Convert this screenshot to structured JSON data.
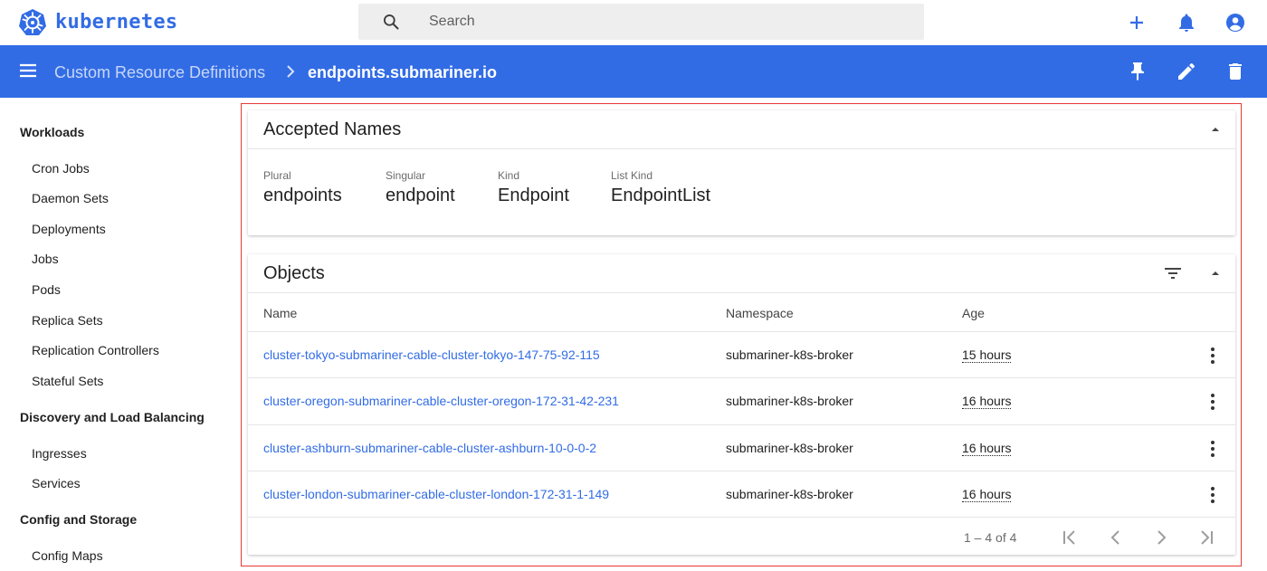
{
  "app": {
    "brand": "kubernetes"
  },
  "search": {
    "placeholder": "Search"
  },
  "topbar_actions": [
    "add-icon",
    "notifications-icon",
    "account-icon"
  ],
  "header": {
    "breadcrumb_parent": "Custom Resource Definitions",
    "breadcrumb_current": "endpoints.submariner.io",
    "actions": [
      "pin-icon",
      "edit-icon",
      "delete-icon"
    ]
  },
  "sidebar": {
    "sections": [
      {
        "title": "Workloads",
        "items": [
          "Cron Jobs",
          "Daemon Sets",
          "Deployments",
          "Jobs",
          "Pods",
          "Replica Sets",
          "Replication Controllers",
          "Stateful Sets"
        ]
      },
      {
        "title": "Discovery and Load Balancing",
        "items": [
          "Ingresses",
          "Services"
        ]
      },
      {
        "title": "Config and Storage",
        "items": [
          "Config Maps"
        ]
      }
    ]
  },
  "accepted_names": {
    "title": "Accepted Names",
    "fields": [
      {
        "label": "Plural",
        "value": "endpoints"
      },
      {
        "label": "Singular",
        "value": "endpoint"
      },
      {
        "label": "Kind",
        "value": "Endpoint"
      },
      {
        "label": "List Kind",
        "value": "EndpointList"
      }
    ]
  },
  "objects": {
    "title": "Objects",
    "columns": {
      "name": "Name",
      "namespace": "Namespace",
      "age": "Age"
    },
    "rows": [
      {
        "name": "cluster-tokyo-submariner-cable-cluster-tokyo-147-75-92-115",
        "namespace": "submariner-k8s-broker",
        "age": "15 hours"
      },
      {
        "name": "cluster-oregon-submariner-cable-cluster-oregon-172-31-42-231",
        "namespace": "submariner-k8s-broker",
        "age": "16 hours"
      },
      {
        "name": "cluster-ashburn-submariner-cable-cluster-ashburn-10-0-0-2",
        "namespace": "submariner-k8s-broker",
        "age": "16 hours"
      },
      {
        "name": "cluster-london-submariner-cable-cluster-london-172-31-1-149",
        "namespace": "submariner-k8s-broker",
        "age": "16 hours"
      }
    ],
    "pagination": "1 – 4 of 4"
  },
  "colors": {
    "brand_blue": "#326ce5",
    "highlight_frame": "#e53935"
  }
}
